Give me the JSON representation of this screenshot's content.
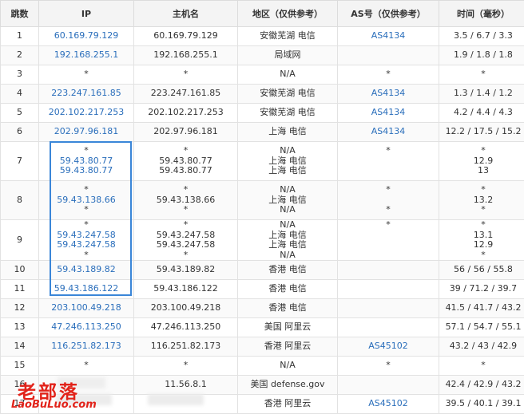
{
  "headers": {
    "hop": "跳数",
    "ip": "IP",
    "host": "主机名",
    "location": "地区（仅供参考）",
    "as": "AS号（仅供参考）",
    "time": "时间（毫秒）"
  },
  "rows": [
    {
      "hop": "1",
      "ip": [
        "60.169.79.129"
      ],
      "host": [
        "60.169.79.129"
      ],
      "loc": [
        "安徽芜湖 电信"
      ],
      "as": [
        "AS4134"
      ],
      "time": [
        "3.5 / 6.7 / 3.3"
      ]
    },
    {
      "hop": "2",
      "ip": [
        "192.168.255.1"
      ],
      "host": [
        "192.168.255.1"
      ],
      "loc": [
        "局域网"
      ],
      "as": [
        ""
      ],
      "time": [
        "1.9 / 1.8 / 1.8"
      ]
    },
    {
      "hop": "3",
      "ip": [
        "*"
      ],
      "host": [
        "*"
      ],
      "loc": [
        "N/A"
      ],
      "as": [
        "*"
      ],
      "time": [
        "*"
      ]
    },
    {
      "hop": "4",
      "ip": [
        "223.247.161.85"
      ],
      "host": [
        "223.247.161.85"
      ],
      "loc": [
        "安徽芜湖 电信"
      ],
      "as": [
        "AS4134"
      ],
      "time": [
        "1.3 / 1.4 / 1.2"
      ]
    },
    {
      "hop": "5",
      "ip": [
        "202.102.217.253"
      ],
      "host": [
        "202.102.217.253"
      ],
      "loc": [
        "安徽芜湖 电信"
      ],
      "as": [
        "AS4134"
      ],
      "time": [
        "4.2 / 4.4 / 4.3"
      ]
    },
    {
      "hop": "6",
      "ip": [
        "202.97.96.181"
      ],
      "host": [
        "202.97.96.181"
      ],
      "loc": [
        "上海 电信"
      ],
      "as": [
        "AS4134"
      ],
      "time": [
        "12.2 / 17.5 / 15.2"
      ]
    },
    {
      "hop": "7",
      "ip": [
        "*",
        "59.43.80.77",
        "59.43.80.77"
      ],
      "host": [
        "*",
        "59.43.80.77",
        "59.43.80.77"
      ],
      "loc": [
        "N/A",
        "上海 电信",
        "上海 电信"
      ],
      "as": [
        "*",
        "",
        ""
      ],
      "time": [
        "*",
        "12.9",
        "13"
      ]
    },
    {
      "hop": "8",
      "ip": [
        "*",
        "59.43.138.66",
        "*"
      ],
      "host": [
        "*",
        "59.43.138.66",
        "*"
      ],
      "loc": [
        "N/A",
        "上海 电信",
        "N/A"
      ],
      "as": [
        "*",
        "",
        "*"
      ],
      "time": [
        "*",
        "13.2",
        "*"
      ]
    },
    {
      "hop": "9",
      "ip": [
        "*",
        "59.43.247.58",
        "59.43.247.58",
        "*"
      ],
      "host": [
        "*",
        "59.43.247.58",
        "59.43.247.58",
        "*"
      ],
      "loc": [
        "N/A",
        "上海 电信",
        "上海 电信",
        "N/A"
      ],
      "as": [
        "*",
        "",
        "",
        ""
      ],
      "time": [
        "*",
        "13.1",
        "12.9",
        "*"
      ]
    },
    {
      "hop": "10",
      "ip": [
        "59.43.189.82"
      ],
      "host": [
        "59.43.189.82"
      ],
      "loc": [
        "香港 电信"
      ],
      "as": [
        ""
      ],
      "time": [
        "56 / 56 / 55.8"
      ]
    },
    {
      "hop": "11",
      "ip": [
        "59.43.186.122"
      ],
      "host": [
        "59.43.186.122"
      ],
      "loc": [
        "香港 电信"
      ],
      "as": [
        ""
      ],
      "time": [
        "39 / 71.2 / 39.7"
      ]
    },
    {
      "hop": "12",
      "ip": [
        "203.100.49.218"
      ],
      "host": [
        "203.100.49.218"
      ],
      "loc": [
        "香港 电信"
      ],
      "as": [
        ""
      ],
      "time": [
        "41.5 / 41.7 / 43.2"
      ]
    },
    {
      "hop": "13",
      "ip": [
        "47.246.113.250"
      ],
      "host": [
        "47.246.113.250"
      ],
      "loc": [
        "美国 阿里云"
      ],
      "as": [
        ""
      ],
      "time": [
        "57.1 / 54.7 / 55.1"
      ]
    },
    {
      "hop": "14",
      "ip": [
        "116.251.82.173"
      ],
      "host": [
        "116.251.82.173"
      ],
      "loc": [
        "香港 阿里云"
      ],
      "as": [
        "AS45102"
      ],
      "time": [
        "43.2 / 43 / 42.9"
      ]
    },
    {
      "hop": "15",
      "ip": [
        "*"
      ],
      "host": [
        "*"
      ],
      "loc": [
        "N/A"
      ],
      "as": [
        "*"
      ],
      "time": [
        "*"
      ]
    },
    {
      "hop": "16",
      "ip": [
        ""
      ],
      "host": [
        "11.56.8.1"
      ],
      "loc": [
        "美国 defense.gov"
      ],
      "as": [
        ""
      ],
      "time": [
        "42.4 / 42.9 / 43.2"
      ]
    },
    {
      "hop": "17",
      "ip": [
        ""
      ],
      "host": [
        ""
      ],
      "loc": [
        "香港 阿里云"
      ],
      "as": [
        "AS45102"
      ],
      "time": [
        "39.5 / 40.1 / 39.1"
      ]
    }
  ],
  "watermark": {
    "cn": "老部落",
    "en": "LaoBuLuo.com"
  },
  "colors": {
    "link": "#2a6ebb",
    "highlight": "#3a86d8",
    "watermark": "#e2231a"
  }
}
